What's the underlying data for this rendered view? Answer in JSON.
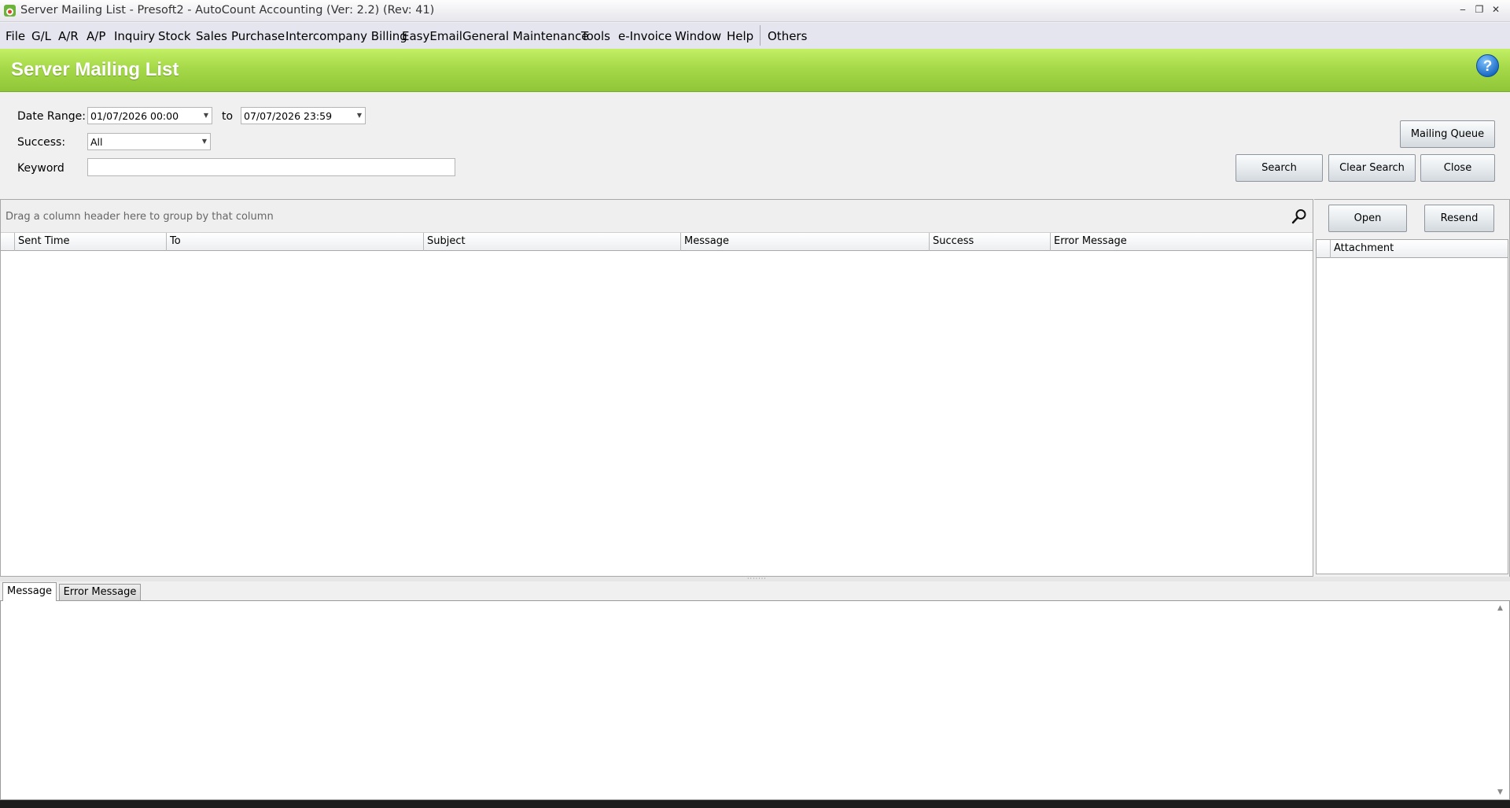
{
  "window": {
    "title": "Server Mailing List - Presoft2 - AutoCount Accounting (Ver: 2.2) (Rev: 41)",
    "minimize": "‒",
    "restore": "❐",
    "close": "✕"
  },
  "menu": {
    "items": [
      "File",
      "G/L",
      "A/R",
      "A/P",
      "Inquiry",
      "Stock",
      "Sales",
      "Purchase",
      "Intercompany Billing",
      "EasyEmail",
      "General Maintenance",
      "Tools",
      "e-Invoice",
      "Window",
      "Help"
    ],
    "others": "Others"
  },
  "header": {
    "title": "Server Mailing List",
    "accent_color": "#a6d94a"
  },
  "filters": {
    "date_range_label": "Date Range:",
    "date_from": "01/07/2026 00:00",
    "to_label": "to",
    "date_to": "07/07/2026 23:59",
    "success_label": "Success:",
    "success_value": "All",
    "keyword_label": "Keyword",
    "keyword_value": ""
  },
  "buttons": {
    "mailing_queue": "Mailing Queue",
    "search": "Search",
    "clear_search": "Clear Search",
    "close": "Close",
    "open": "Open",
    "resend": "Resend"
  },
  "grid": {
    "group_hint": "Drag a column header here to group by that column",
    "columns": [
      "Sent Time",
      "To",
      "Subject",
      "Message",
      "Success",
      "Error Message"
    ],
    "rows": []
  },
  "attachment_grid": {
    "columns": [
      "Attachment"
    ]
  },
  "tabs": {
    "items": [
      "Message",
      "Error Message"
    ],
    "active": "Message"
  },
  "icons": [
    "app-icon",
    "help-icon",
    "search-icon",
    "chevron-down-icon"
  ]
}
